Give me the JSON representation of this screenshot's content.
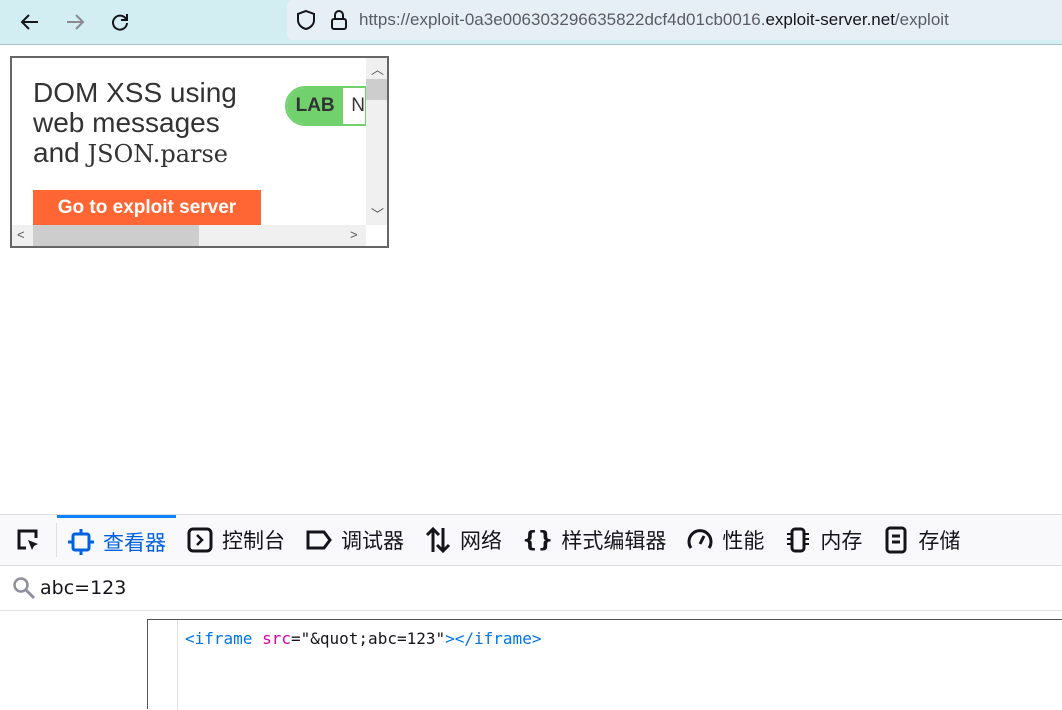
{
  "browser": {
    "url_prefix": "https://exploit-0a3e006303296635822dcf4d01cb0016.",
    "url_domain": "exploit-server.net",
    "url_path": "/exploit"
  },
  "page": {
    "title_line1": "DOM XSS using",
    "title_line2": "web messages",
    "title_and": "and",
    "title_code": "JSON.parse",
    "badge_label": "LAB",
    "badge_status": "N",
    "button": "Go to exploit server"
  },
  "devtools": {
    "tabs": [
      {
        "label": "查看器",
        "icon": "inspector-icon",
        "selected": true
      },
      {
        "label": "控制台",
        "icon": "console-icon"
      },
      {
        "label": "调试器",
        "icon": "debugger-icon"
      },
      {
        "label": "网络",
        "icon": "network-icon"
      },
      {
        "label": "样式编辑器",
        "icon": "style-editor-icon"
      },
      {
        "label": "性能",
        "icon": "performance-icon"
      },
      {
        "label": "内存",
        "icon": "memory-icon"
      },
      {
        "label": "存储",
        "icon": "storage-icon"
      }
    ],
    "search_value": "abc=123",
    "code": {
      "open": "<iframe",
      "attr": "src",
      "eq": "=",
      "value": "\"&quot;abc=123\"",
      "close": "></iframe>"
    },
    "accent": "#0a84ff"
  }
}
